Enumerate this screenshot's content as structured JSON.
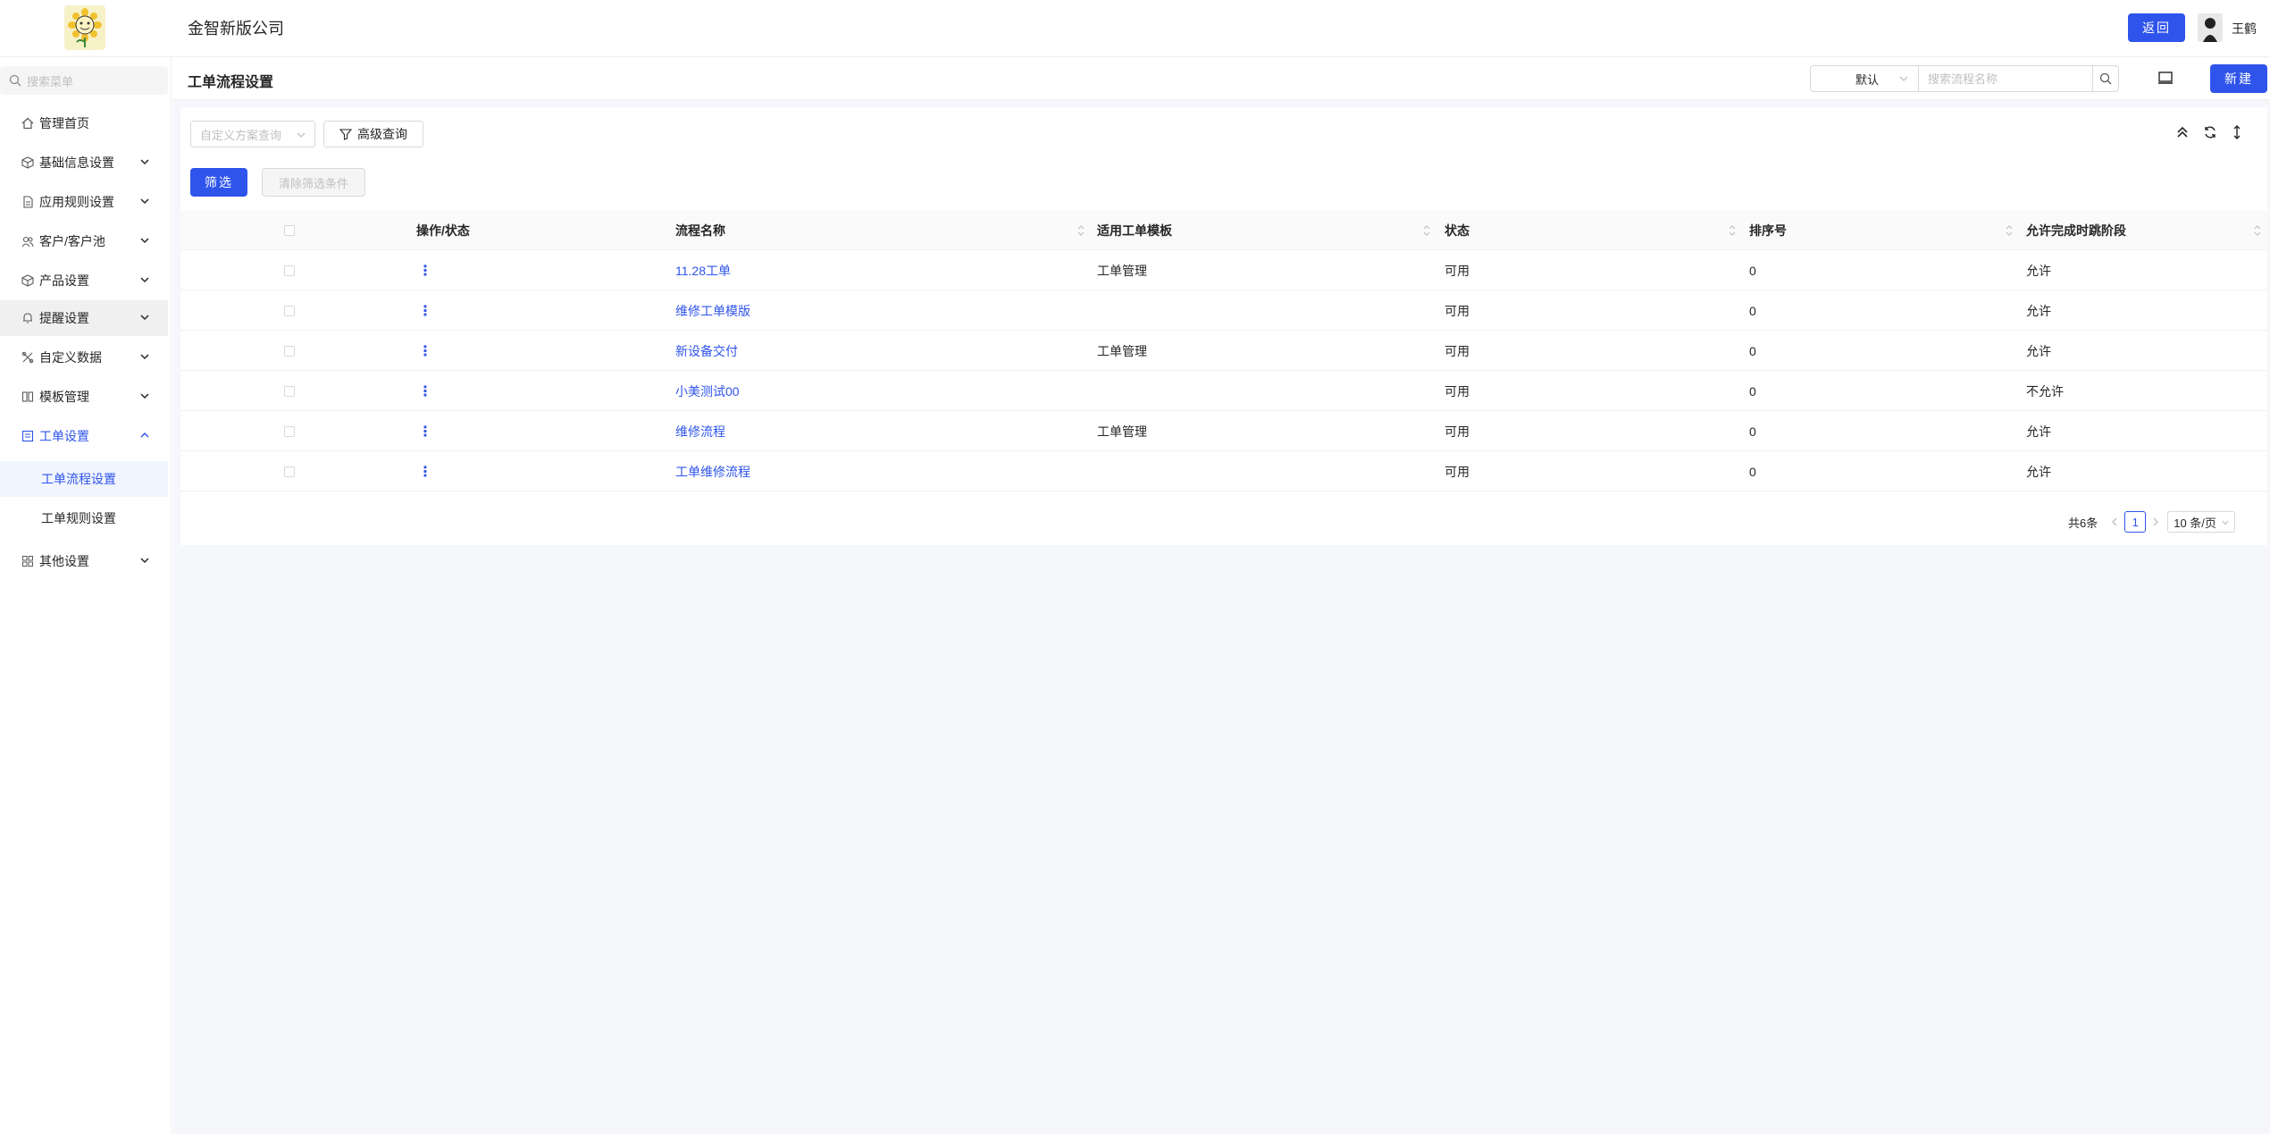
{
  "header": {
    "company": "金智新版公司",
    "back_label": "返回",
    "username": "王鹤"
  },
  "sidebar": {
    "search_placeholder": "搜索菜单",
    "items": [
      {
        "label": "管理首页",
        "icon": "home-icon"
      },
      {
        "label": "基础信息设置",
        "icon": "cube-icon"
      },
      {
        "label": "应用规则设置",
        "icon": "file-icon"
      },
      {
        "label": "客户/客户池",
        "icon": "users-icon"
      },
      {
        "label": "产品设置",
        "icon": "box-icon"
      },
      {
        "label": "提醒设置",
        "icon": "bell-icon"
      },
      {
        "label": "自定义数据",
        "icon": "custom-data-icon"
      },
      {
        "label": "模板管理",
        "icon": "template-icon"
      },
      {
        "label": "工单设置",
        "icon": "ticket-icon"
      },
      {
        "label": "其他设置",
        "icon": "grid-icon"
      }
    ],
    "sub_items": [
      {
        "label": "工单流程设置"
      },
      {
        "label": "工单规则设置"
      }
    ]
  },
  "page": {
    "title": "工单流程设置",
    "select_value": "默认",
    "search_placeholder": "搜索流程名称",
    "new_label": "新建"
  },
  "filters": {
    "query_placeholder": "自定义方案查询",
    "advanced_label": "高级查询",
    "filter_label": "筛选",
    "clear_label": "清除筛选条件"
  },
  "table": {
    "columns": [
      "操作/状态",
      "流程名称",
      "适用工单模板",
      "状态",
      "排序号",
      "允许完成时跳阶段"
    ],
    "rows": [
      {
        "name": "11.28工单",
        "template": "工单管理",
        "status": "可用",
        "order": "0",
        "allow": "允许"
      },
      {
        "name": "维修工单模版",
        "template": "",
        "status": "可用",
        "order": "0",
        "allow": "允许"
      },
      {
        "name": "新设备交付",
        "template": "工单管理",
        "status": "可用",
        "order": "0",
        "allow": "允许"
      },
      {
        "name": "小美测试00",
        "template": "",
        "status": "可用",
        "order": "0",
        "allow": "不允许"
      },
      {
        "name": "维修流程",
        "template": "工单管理",
        "status": "可用",
        "order": "0",
        "allow": "允许"
      },
      {
        "name": "工单维修流程",
        "template": "",
        "status": "可用",
        "order": "0",
        "allow": "允许"
      }
    ]
  },
  "pagination": {
    "total": "共6条",
    "current": "1",
    "page_size": "10 条/页"
  },
  "colors": {
    "primary": "#2f54eb",
    "page_bg": "#f5f7fb"
  }
}
